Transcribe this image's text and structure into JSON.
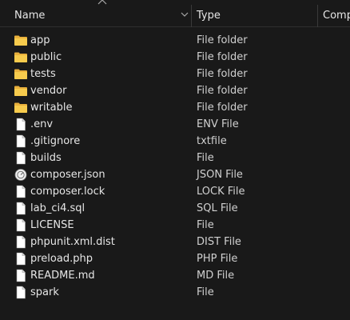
{
  "columns": {
    "name": "Name",
    "type": "Type",
    "comp": "Comp"
  },
  "files": [
    {
      "name": "app",
      "type": "File folder",
      "icon": "folder-icon"
    },
    {
      "name": "public",
      "type": "File folder",
      "icon": "folder-icon"
    },
    {
      "name": "tests",
      "type": "File folder",
      "icon": "folder-icon"
    },
    {
      "name": "vendor",
      "type": "File folder",
      "icon": "folder-icon"
    },
    {
      "name": "writable",
      "type": "File folder",
      "icon": "folder-icon"
    },
    {
      "name": ".env",
      "type": "ENV File",
      "icon": "file-icon"
    },
    {
      "name": ".gitignore",
      "type": "txtfile",
      "icon": "file-icon"
    },
    {
      "name": "builds",
      "type": "File",
      "icon": "file-icon"
    },
    {
      "name": "composer.json",
      "type": "JSON File",
      "icon": "json-file-icon"
    },
    {
      "name": "composer.lock",
      "type": "LOCK File",
      "icon": "file-icon"
    },
    {
      "name": "lab_ci4.sql",
      "type": "SQL File",
      "icon": "file-icon"
    },
    {
      "name": "LICENSE",
      "type": "File",
      "icon": "file-icon"
    },
    {
      "name": "phpunit.xml.dist",
      "type": "DIST File",
      "icon": "file-icon"
    },
    {
      "name": "preload.php",
      "type": "PHP File",
      "icon": "file-icon"
    },
    {
      "name": "README.md",
      "type": "MD File",
      "icon": "file-icon"
    },
    {
      "name": "spark",
      "type": "File",
      "icon": "file-icon"
    }
  ],
  "colors": {
    "background": "#191919",
    "folder": "#f4c542",
    "text": "#e6e6e6"
  }
}
